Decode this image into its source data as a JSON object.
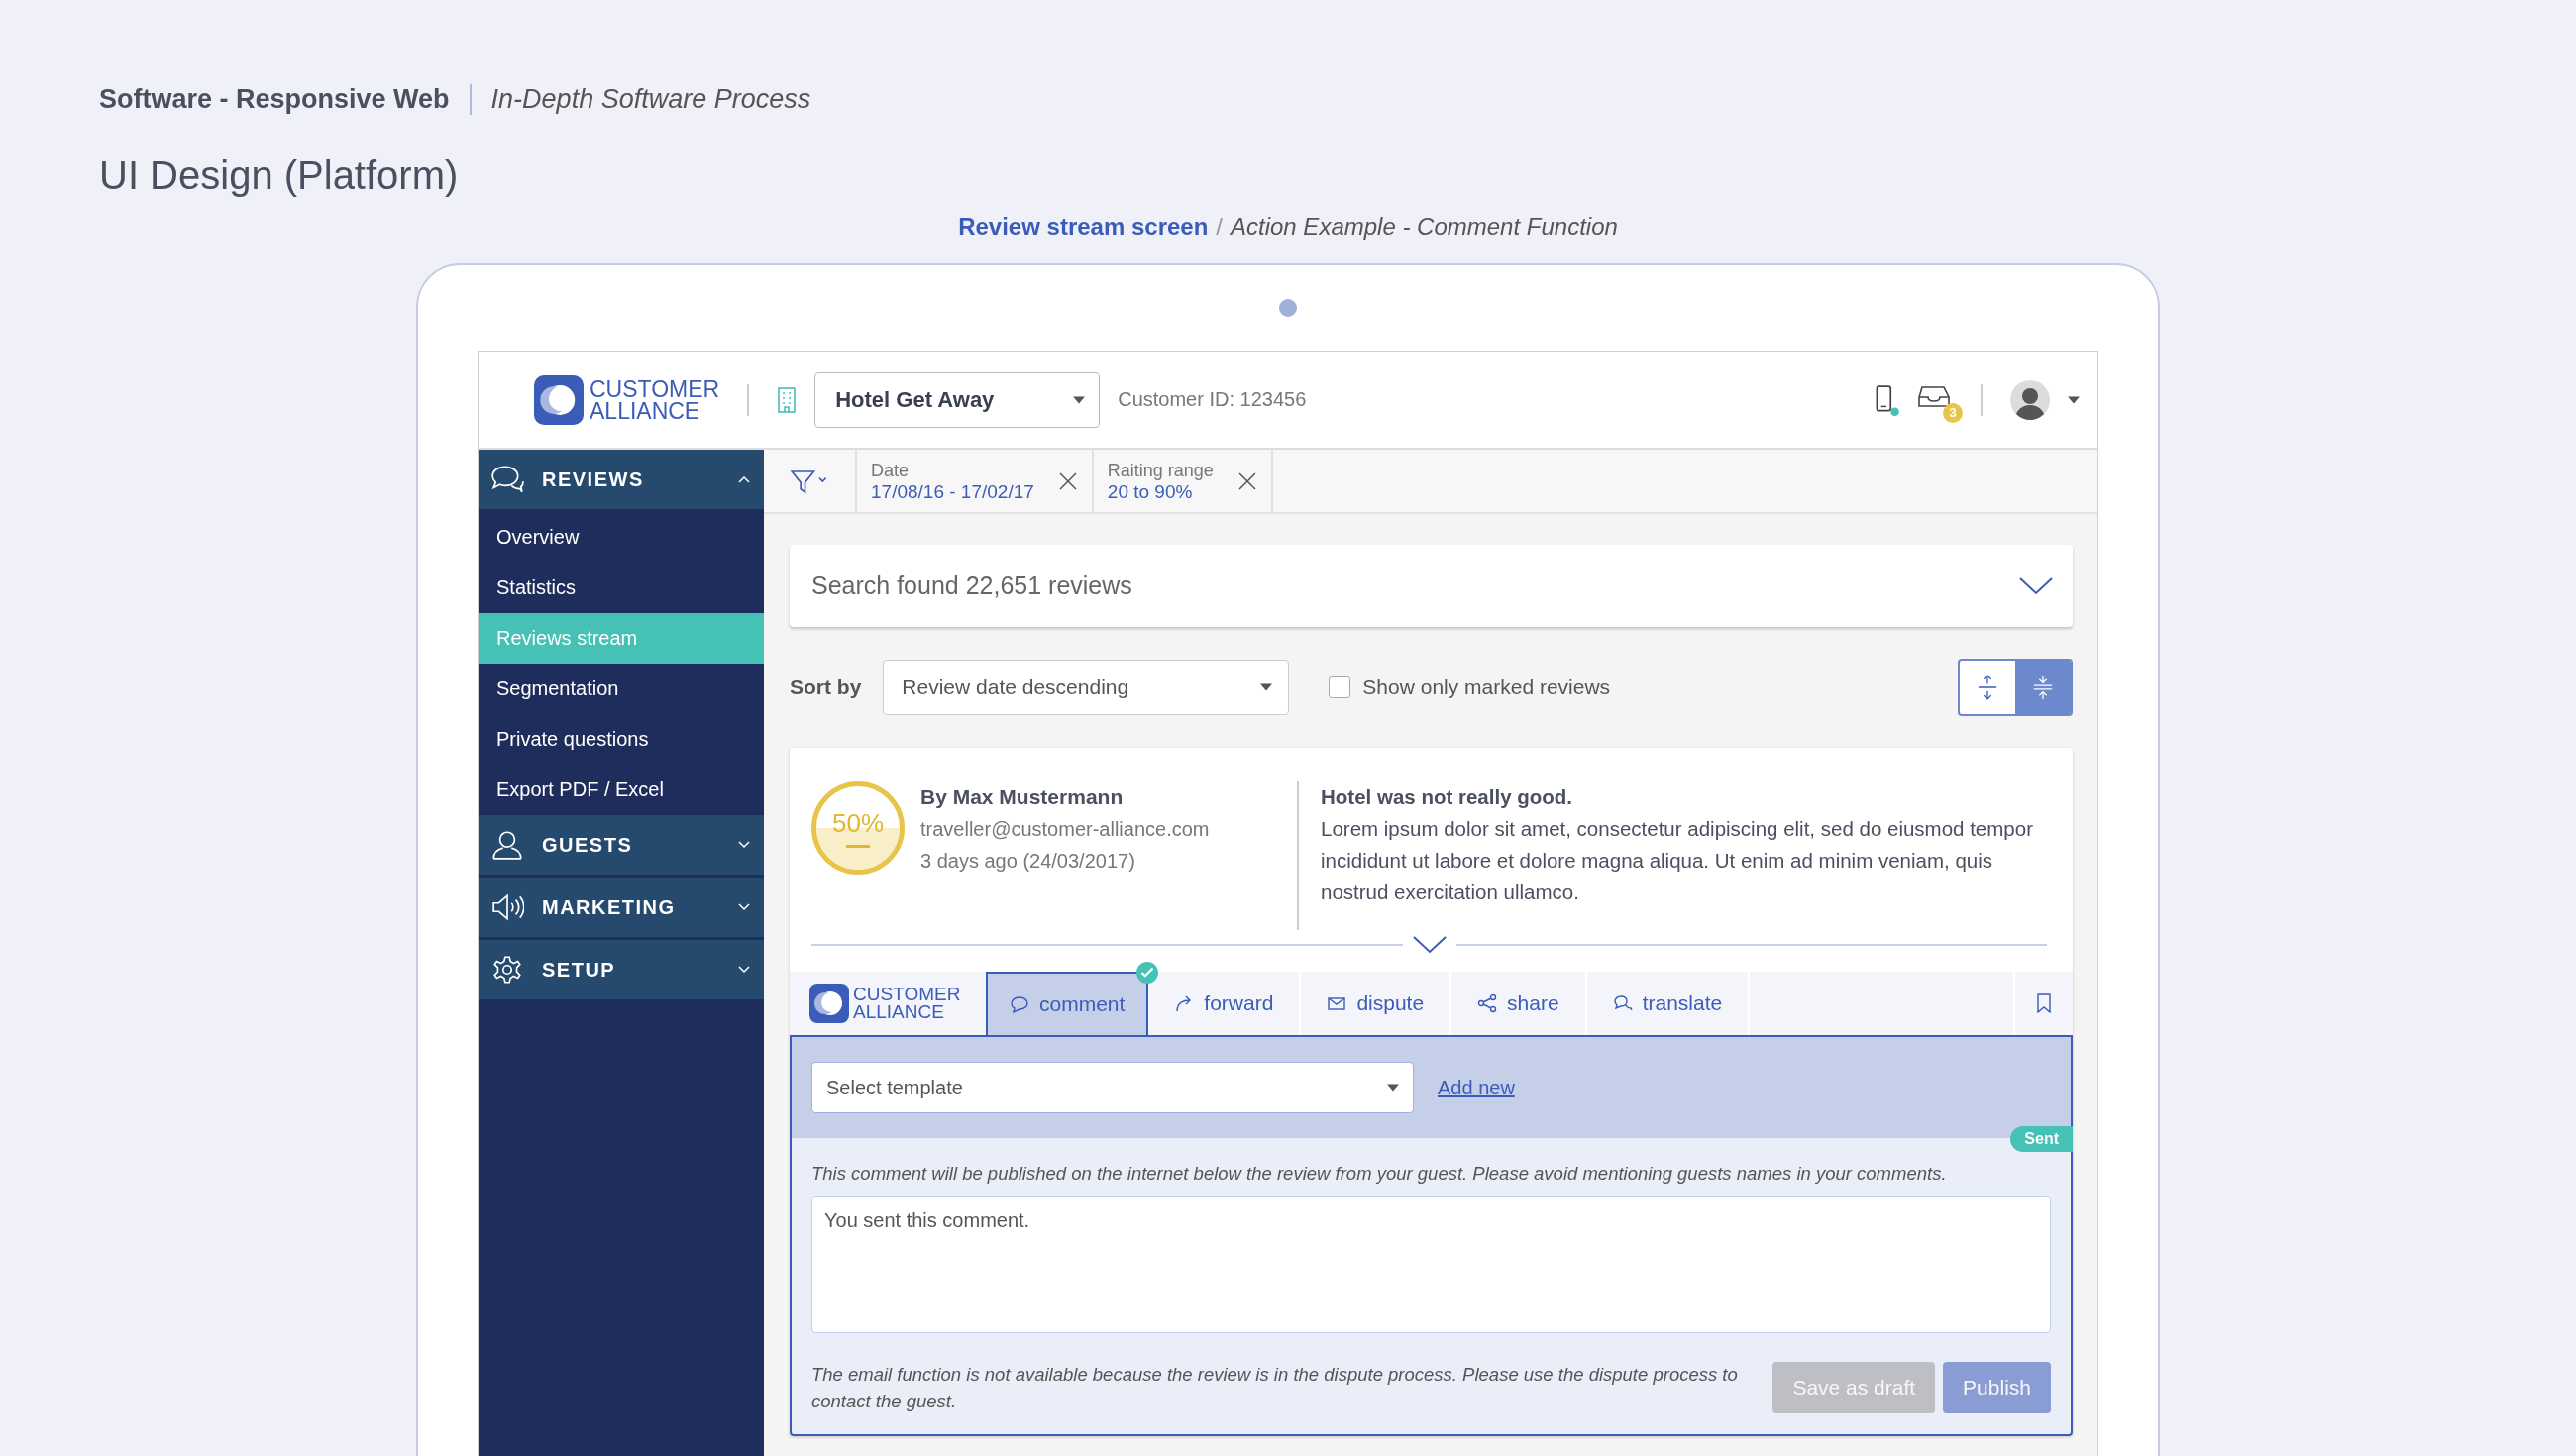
{
  "header": {
    "category": "Software - Responsive Web",
    "subtitle": "In-Depth Software Process",
    "title": "UI Design (Platform)"
  },
  "caption": {
    "screen": "Review stream screen",
    "separator": "/",
    "example": "Action Example - Comment Function"
  },
  "topbar": {
    "logo": [
      "CUSTOMER",
      "ALLIANCE"
    ],
    "hotel": "Hotel Get Away",
    "customer_id": "Customer ID: 123456",
    "inbox_count": "3"
  },
  "sidebar": [
    {
      "kind": "reviews",
      "label": "REVIEWS",
      "expanded": true,
      "items": [
        {
          "label": "Overview",
          "selected": false
        },
        {
          "label": "Statistics",
          "selected": false
        },
        {
          "label": "Reviews stream",
          "selected": true
        },
        {
          "label": "Segmentation",
          "selected": false
        },
        {
          "label": "Private questions",
          "selected": false
        },
        {
          "label": "Export PDF / Excel",
          "selected": false
        }
      ]
    },
    {
      "kind": "guests",
      "label": "GUESTS",
      "expanded": false
    },
    {
      "kind": "marketing",
      "label": "MARKETING",
      "expanded": false
    },
    {
      "kind": "setup",
      "label": "SETUP",
      "expanded": false
    }
  ],
  "filters": [
    {
      "label": "Date",
      "value": "17/08/16 - 17/02/17"
    },
    {
      "label": "Raiting range",
      "value": "20 to 90%"
    }
  ],
  "search_summary": "Search found 22,651 reviews",
  "sort": {
    "label": "Sort by",
    "value": "Review date descending"
  },
  "marked_filter": {
    "label": "Show only marked reviews",
    "checked": false
  },
  "view_toggle": [
    {
      "kind": "expand",
      "selected": false
    },
    {
      "kind": "collapse",
      "selected": true
    }
  ],
  "review": {
    "score": "50%",
    "author": "By Max Mustermann",
    "email": "traveller@customer-alliance.com",
    "date": "3 days ago (24/03/2017)",
    "title": "Hotel was not really good.",
    "body": "Lorem ipsum dolor sit amet, consectetur adipiscing elit, sed do eiusmod tempor incididunt ut labore et dolore magna aliqua. Ut enim ad minim veniam, quis nostrud exercitation ullamco."
  },
  "action_bar_logo": [
    "CUSTOMER",
    "ALLIANCE"
  ],
  "action_tabs": [
    {
      "kind": "comment",
      "label": "comment",
      "selected": true,
      "done": true
    },
    {
      "kind": "forward",
      "label": "forward",
      "selected": false,
      "done": false
    },
    {
      "kind": "dispute",
      "label": "dispute",
      "selected": false,
      "done": false
    },
    {
      "kind": "share",
      "label": "share",
      "selected": false,
      "done": false
    },
    {
      "kind": "translate",
      "label": "translate",
      "selected": false,
      "done": false
    }
  ],
  "comment_panel": {
    "template_select": {
      "placeholder": "Select template"
    },
    "add_new": "Add new",
    "status": "Sent",
    "notice": "This comment will be published on the internet below the review from your guest. Please avoid mentioning guests names in your comments.",
    "comment": "You sent this comment.",
    "footer_note": "The email function is not available because the review is in the dispute process. Please use the dispute process to contact the guest.",
    "buttons": [
      {
        "kind": "secondary",
        "label": "Save as draft",
        "disabled": true
      },
      {
        "kind": "primary",
        "label": "Publish",
        "disabled": true
      }
    ]
  }
}
